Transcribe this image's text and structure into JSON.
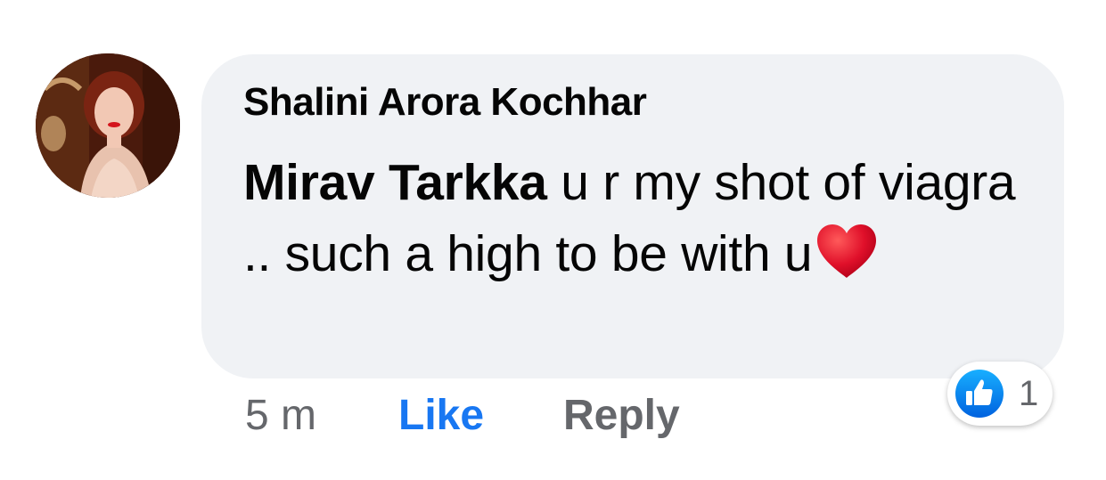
{
  "comment": {
    "author": "Shalini Arora Kochhar",
    "mention": "Mirav Tarkka",
    "text": " u r my shot of viagra .. such a high to be with u",
    "emoji": "heart",
    "timestamp": "5 m",
    "like_label": "Like",
    "reply_label": "Reply",
    "reaction_count": "1",
    "reaction_type": "like-icon"
  },
  "colors": {
    "bubble": "#f0f2f5",
    "like_active": "#1877f2",
    "secondary_text": "#65676b",
    "heart": "#e0102a"
  }
}
